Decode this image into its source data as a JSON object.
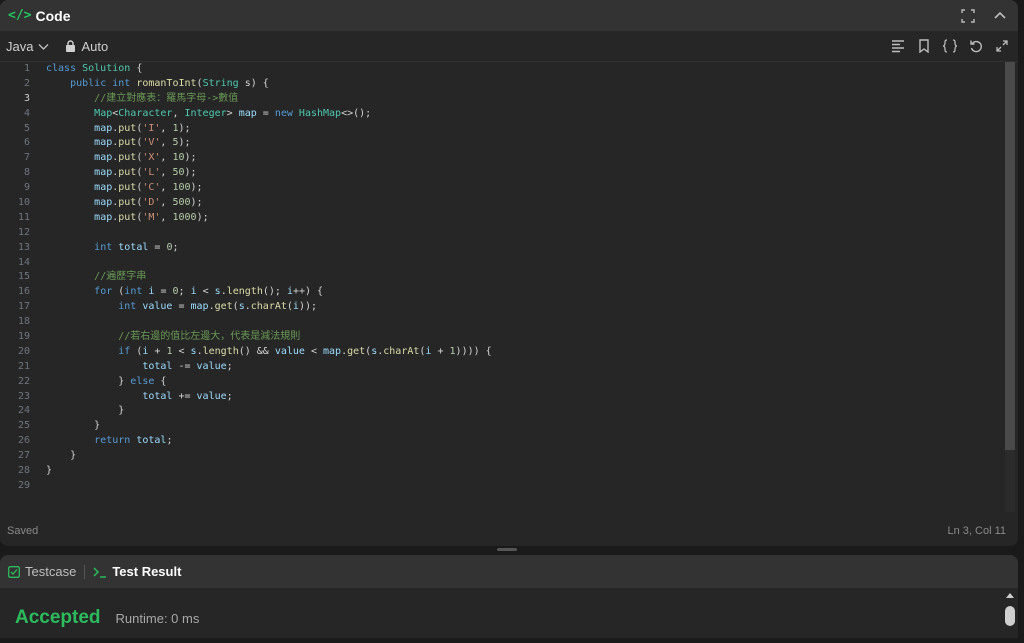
{
  "code_panel": {
    "icon": "code-brackets-icon",
    "title": "Code",
    "language": "Java",
    "mode": "Auto",
    "saved_label": "Saved",
    "cursor_position": "Ln 3, Col 11",
    "current_line": 3
  },
  "code_lines": [
    [
      [
        "kw",
        "class "
      ],
      [
        "ty",
        "Solution"
      ],
      [
        "pl",
        " {"
      ]
    ],
    [
      [
        "pl",
        "    "
      ],
      [
        "kw",
        "public int "
      ],
      [
        "fn",
        "romanToInt"
      ],
      [
        "pl",
        "("
      ],
      [
        "ty",
        "String"
      ],
      [
        "pl",
        " s) {"
      ]
    ],
    [
      [
        "pl",
        "        "
      ],
      [
        "cm",
        "//建立對應表：羅馬字母->數值"
      ]
    ],
    [
      [
        "pl",
        "        "
      ],
      [
        "ty",
        "Map"
      ],
      [
        "pl",
        "<"
      ],
      [
        "ty",
        "Character"
      ],
      [
        "pl",
        ", "
      ],
      [
        "ty",
        "Integer"
      ],
      [
        "pl",
        "> "
      ],
      [
        "va",
        "map"
      ],
      [
        "pl",
        " = "
      ],
      [
        "kw",
        "new "
      ],
      [
        "ty",
        "HashMap"
      ],
      [
        "pl",
        "<>();"
      ]
    ],
    [
      [
        "pl",
        "        "
      ],
      [
        "va",
        "map"
      ],
      [
        "pl",
        "."
      ],
      [
        "fn",
        "put"
      ],
      [
        "pl",
        "("
      ],
      [
        "st",
        "'I'"
      ],
      [
        "pl",
        ", "
      ],
      [
        "nm",
        "1"
      ],
      [
        "pl",
        ");"
      ]
    ],
    [
      [
        "pl",
        "        "
      ],
      [
        "va",
        "map"
      ],
      [
        "pl",
        "."
      ],
      [
        "fn",
        "put"
      ],
      [
        "pl",
        "("
      ],
      [
        "st",
        "'V'"
      ],
      [
        "pl",
        ", "
      ],
      [
        "nm",
        "5"
      ],
      [
        "pl",
        ");"
      ]
    ],
    [
      [
        "pl",
        "        "
      ],
      [
        "va",
        "map"
      ],
      [
        "pl",
        "."
      ],
      [
        "fn",
        "put"
      ],
      [
        "pl",
        "("
      ],
      [
        "st",
        "'X'"
      ],
      [
        "pl",
        ", "
      ],
      [
        "nm",
        "10"
      ],
      [
        "pl",
        ");"
      ]
    ],
    [
      [
        "pl",
        "        "
      ],
      [
        "va",
        "map"
      ],
      [
        "pl",
        "."
      ],
      [
        "fn",
        "put"
      ],
      [
        "pl",
        "("
      ],
      [
        "st",
        "'L'"
      ],
      [
        "pl",
        ", "
      ],
      [
        "nm",
        "50"
      ],
      [
        "pl",
        ");"
      ]
    ],
    [
      [
        "pl",
        "        "
      ],
      [
        "va",
        "map"
      ],
      [
        "pl",
        "."
      ],
      [
        "fn",
        "put"
      ],
      [
        "pl",
        "("
      ],
      [
        "st",
        "'C'"
      ],
      [
        "pl",
        ", "
      ],
      [
        "nm",
        "100"
      ],
      [
        "pl",
        ");"
      ]
    ],
    [
      [
        "pl",
        "        "
      ],
      [
        "va",
        "map"
      ],
      [
        "pl",
        "."
      ],
      [
        "fn",
        "put"
      ],
      [
        "pl",
        "("
      ],
      [
        "st",
        "'D'"
      ],
      [
        "pl",
        ", "
      ],
      [
        "nm",
        "500"
      ],
      [
        "pl",
        ");"
      ]
    ],
    [
      [
        "pl",
        "        "
      ],
      [
        "va",
        "map"
      ],
      [
        "pl",
        "."
      ],
      [
        "fn",
        "put"
      ],
      [
        "pl",
        "("
      ],
      [
        "st",
        "'M'"
      ],
      [
        "pl",
        ", "
      ],
      [
        "nm",
        "1000"
      ],
      [
        "pl",
        ");"
      ]
    ],
    [],
    [
      [
        "pl",
        "        "
      ],
      [
        "kw",
        "int "
      ],
      [
        "va",
        "total"
      ],
      [
        "pl",
        " = "
      ],
      [
        "nm",
        "0"
      ],
      [
        "pl",
        ";"
      ]
    ],
    [],
    [
      [
        "pl",
        "        "
      ],
      [
        "cm",
        "//遍歷字串"
      ]
    ],
    [
      [
        "pl",
        "        "
      ],
      [
        "kw",
        "for "
      ],
      [
        "pl",
        "("
      ],
      [
        "kw",
        "int "
      ],
      [
        "va",
        "i"
      ],
      [
        "pl",
        " = "
      ],
      [
        "nm",
        "0"
      ],
      [
        "pl",
        "; "
      ],
      [
        "va",
        "i"
      ],
      [
        "pl",
        " < "
      ],
      [
        "va",
        "s"
      ],
      [
        "pl",
        "."
      ],
      [
        "fn",
        "length"
      ],
      [
        "pl",
        "(); "
      ],
      [
        "va",
        "i"
      ],
      [
        "pl",
        "++) {"
      ]
    ],
    [
      [
        "pl",
        "            "
      ],
      [
        "kw",
        "int "
      ],
      [
        "va",
        "value"
      ],
      [
        "pl",
        " = "
      ],
      [
        "va",
        "map"
      ],
      [
        "pl",
        "."
      ],
      [
        "fn",
        "get"
      ],
      [
        "pl",
        "("
      ],
      [
        "va",
        "s"
      ],
      [
        "pl",
        "."
      ],
      [
        "fn",
        "charAt"
      ],
      [
        "pl",
        "("
      ],
      [
        "va",
        "i"
      ],
      [
        "pl",
        "));"
      ]
    ],
    [],
    [
      [
        "pl",
        "            "
      ],
      [
        "cm",
        "//若右邊的值比左邊大，代表是減法規則"
      ]
    ],
    [
      [
        "pl",
        "            "
      ],
      [
        "kw",
        "if "
      ],
      [
        "pl",
        "("
      ],
      [
        "va",
        "i"
      ],
      [
        "pl",
        " + "
      ],
      [
        "nm",
        "1"
      ],
      [
        "pl",
        " < "
      ],
      [
        "va",
        "s"
      ],
      [
        "pl",
        "."
      ],
      [
        "fn",
        "length"
      ],
      [
        "pl",
        "() && "
      ],
      [
        "va",
        "value"
      ],
      [
        "pl",
        " < "
      ],
      [
        "va",
        "map"
      ],
      [
        "pl",
        "."
      ],
      [
        "fn",
        "get"
      ],
      [
        "pl",
        "("
      ],
      [
        "va",
        "s"
      ],
      [
        "pl",
        "."
      ],
      [
        "fn",
        "charAt"
      ],
      [
        "pl",
        "("
      ],
      [
        "va",
        "i"
      ],
      [
        "pl",
        " + "
      ],
      [
        "nm",
        "1"
      ],
      [
        "pl",
        ")))) {"
      ]
    ],
    [
      [
        "pl",
        "                "
      ],
      [
        "va",
        "total"
      ],
      [
        "pl",
        " -= "
      ],
      [
        "va",
        "value"
      ],
      [
        "pl",
        ";"
      ]
    ],
    [
      [
        "pl",
        "            } "
      ],
      [
        "kw",
        "else "
      ],
      [
        "pl",
        "{"
      ]
    ],
    [
      [
        "pl",
        "                "
      ],
      [
        "va",
        "total"
      ],
      [
        "pl",
        " += "
      ],
      [
        "va",
        "value"
      ],
      [
        "pl",
        ";"
      ]
    ],
    [
      [
        "pl",
        "            }"
      ]
    ],
    [
      [
        "pl",
        "        }"
      ]
    ],
    [
      [
        "pl",
        "        "
      ],
      [
        "kw",
        "return "
      ],
      [
        "va",
        "total"
      ],
      [
        "pl",
        ";"
      ]
    ],
    [
      [
        "pl",
        "    }"
      ]
    ],
    [
      [
        "pl",
        "}"
      ]
    ],
    []
  ],
  "result_panel": {
    "tab_testcase": "Testcase",
    "tab_result": "Test Result",
    "status": "Accepted",
    "runtime": "Runtime: 0 ms"
  },
  "colors": {
    "accent_green": "#2cbb5d",
    "panel_bg": "#262626",
    "header_bg": "#333333"
  }
}
